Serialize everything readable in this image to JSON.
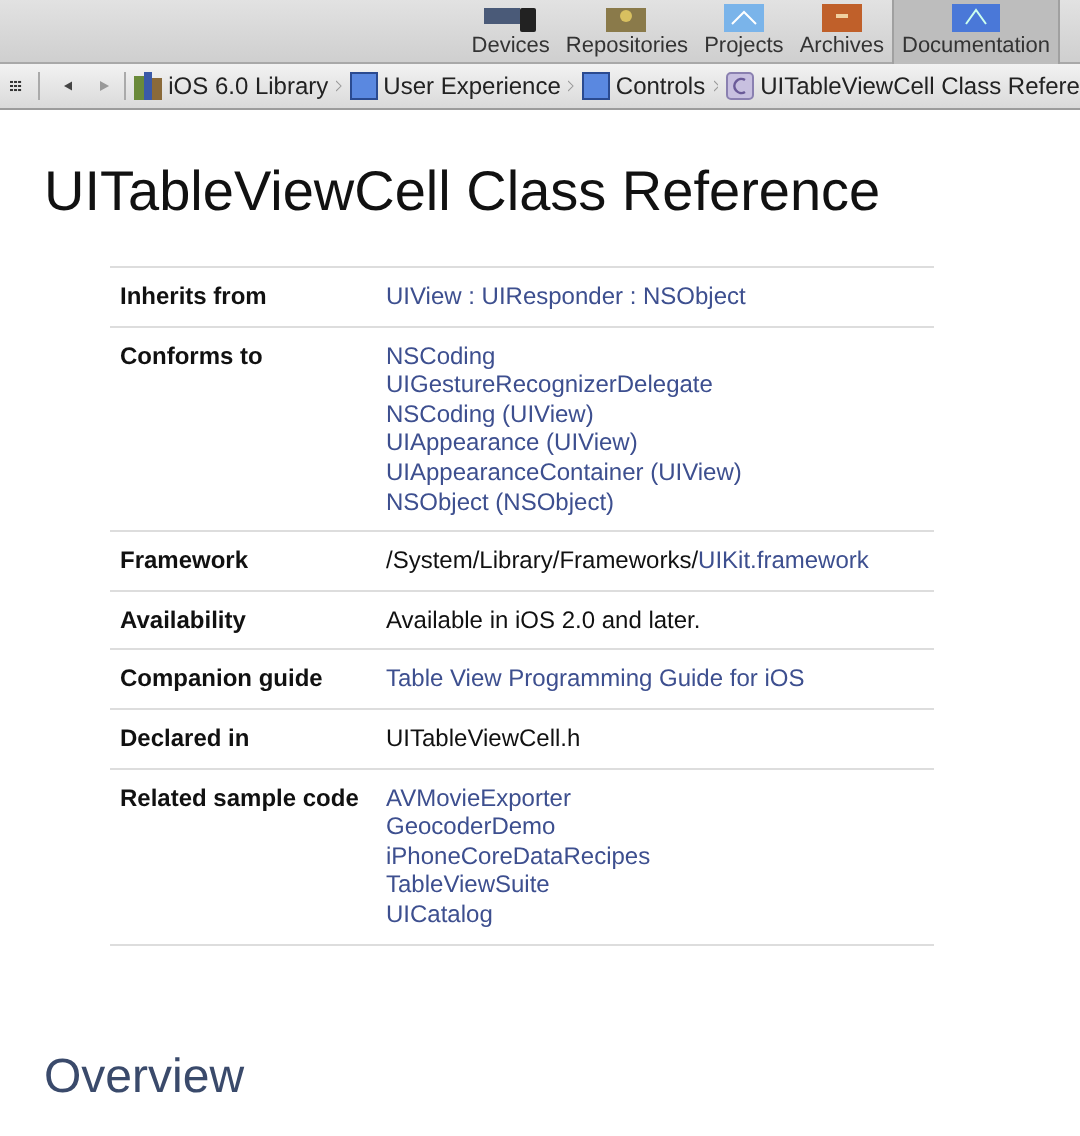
{
  "toolbar": {
    "items": [
      {
        "label": "Devices",
        "selected": false,
        "kind": "devices"
      },
      {
        "label": "Repositories",
        "selected": false,
        "kind": "repositories"
      },
      {
        "label": "Projects",
        "selected": false,
        "kind": "projects"
      },
      {
        "label": "Archives",
        "selected": false,
        "kind": "archives"
      },
      {
        "label": "Documentation",
        "selected": true,
        "kind": "documentation"
      }
    ]
  },
  "breadcrumbs": [
    {
      "label": "iOS 6.0 Library",
      "kind": "library"
    },
    {
      "label": "User Experience",
      "kind": "folder"
    },
    {
      "label": "Controls",
      "kind": "folder"
    },
    {
      "label": "UITableViewCell Class Refere",
      "kind": "class"
    }
  ],
  "title": "UITableViewCell Class Reference",
  "table": {
    "rows": [
      {
        "label": "Inherits from",
        "lines": [
          [
            {
              "text": "UIView : UIResponder : NSObject",
              "link": true
            }
          ]
        ]
      },
      {
        "label": "Conforms to",
        "lines": [
          [
            {
              "text": "NSCoding",
              "link": true
            }
          ],
          [
            {
              "text": "UIGestureRecognizerDelegate",
              "link": true
            }
          ],
          [
            {
              "text": "NSCoding (UIView)",
              "link": true
            }
          ],
          [
            {
              "text": "UIAppearance (UIView)",
              "link": true
            }
          ],
          [
            {
              "text": "UIAppearanceContainer (UIView)",
              "link": true
            }
          ],
          [
            {
              "text": "NSObject (NSObject)",
              "link": true
            }
          ]
        ]
      },
      {
        "label": "Framework",
        "lines": [
          [
            {
              "text": "/System/Library/Frameworks/",
              "link": false
            },
            {
              "text": "UIKit.framework",
              "link": true
            }
          ]
        ]
      },
      {
        "label": "Availability",
        "lines": [
          [
            {
              "text": "Available in iOS 2.0 and later.",
              "link": false
            }
          ]
        ]
      },
      {
        "label": "Companion guide",
        "lines": [
          [
            {
              "text": "Table View Programming Guide for iOS",
              "link": true
            }
          ]
        ]
      },
      {
        "label": "Declared in",
        "lines": [
          [
            {
              "text": "UITableViewCell.h",
              "link": false
            }
          ]
        ]
      },
      {
        "label": "Related sample code",
        "lines": [
          [
            {
              "text": "AVMovieExporter",
              "link": true
            }
          ],
          [
            {
              "text": "GeocoderDemo",
              "link": true
            }
          ],
          [
            {
              "text": "iPhoneCoreDataRecipes",
              "link": true
            }
          ],
          [
            {
              "text": "TableViewSuite",
              "link": true
            }
          ],
          [
            {
              "text": "UICatalog",
              "link": true
            }
          ]
        ]
      }
    ]
  },
  "section_heading": "Overview"
}
